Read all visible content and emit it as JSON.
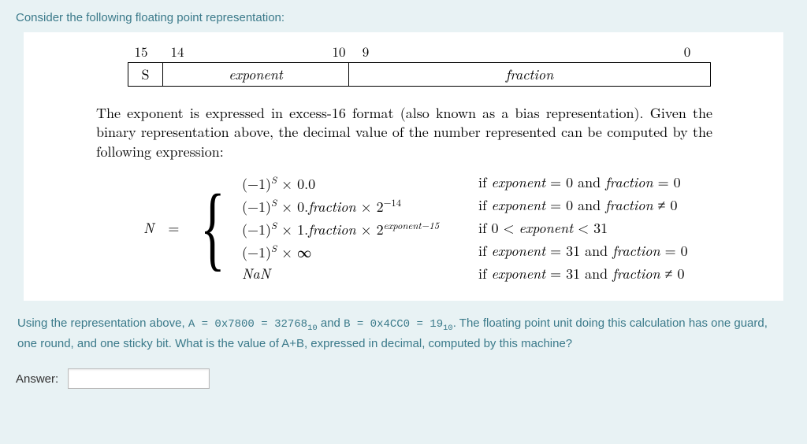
{
  "prompt": "Consider the following floating point representation:",
  "bits": {
    "b15": "15",
    "b14": "14",
    "b10": "10",
    "b9": "9",
    "b0": "0"
  },
  "fields": {
    "s": "S",
    "exponent": "exponent",
    "fraction": "fraction"
  },
  "paragraph": "The exponent is expressed in excess-16 format (also known as a bias representation). Given the binary representation above, the decimal value of the number represented can be computed by the following expression:",
  "formula": {
    "lhs": "N",
    "eq": "=",
    "cases": [
      {
        "expr": "(−1)^S × 0.0",
        "cond": "if exponent = 0 and fraction = 0"
      },
      {
        "expr": "(−1)^S × 0.fraction × 2^−14",
        "cond": "if exponent = 0 and fraction ≠ 0"
      },
      {
        "expr": "(−1)^S × 1.fraction × 2^(exponent−15)",
        "cond": "if 0 < exponent < 31"
      },
      {
        "expr": "(−1)^S × ∞",
        "cond": "if exponent = 31 and fraction = 0"
      },
      {
        "expr": "NaN",
        "cond": "if exponent = 31 and fraction ≠ 0"
      }
    ]
  },
  "question": {
    "pre": "Using the representation above, ",
    "A_label": "A = ",
    "A_hex": "0x7800",
    "eq1": " = ",
    "A_dec": "32768",
    "sub10a": "10",
    "and": " and ",
    "B_label": "B = ",
    "B_hex": "0x4CC0",
    "eq2": " = ",
    "B_dec": "19",
    "sub10b": "10",
    "post": ". The  floating point unit doing this calculation has one guard, one round, and one sticky bit. What is the value of A+B, expressed in decimal, computed by this machine?"
  },
  "answer_label": "Answer:",
  "answer_value": ""
}
